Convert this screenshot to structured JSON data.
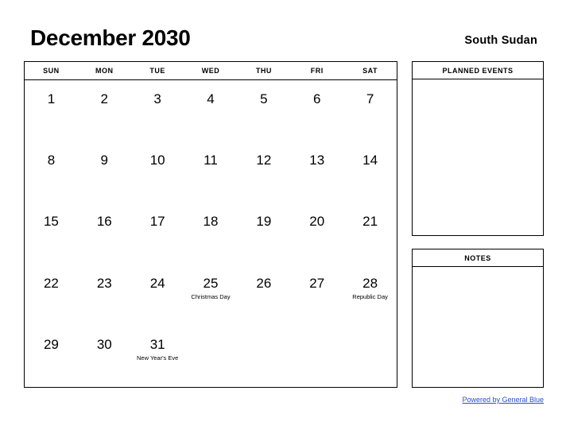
{
  "header": {
    "month_title": "December 2030",
    "country": "South Sudan"
  },
  "calendar": {
    "weekday_headers": [
      "SUN",
      "MON",
      "TUE",
      "WED",
      "THU",
      "FRI",
      "SAT"
    ],
    "weeks": [
      [
        {
          "day": "1",
          "event": ""
        },
        {
          "day": "2",
          "event": ""
        },
        {
          "day": "3",
          "event": ""
        },
        {
          "day": "4",
          "event": ""
        },
        {
          "day": "5",
          "event": ""
        },
        {
          "day": "6",
          "event": ""
        },
        {
          "day": "7",
          "event": ""
        }
      ],
      [
        {
          "day": "8",
          "event": ""
        },
        {
          "day": "9",
          "event": ""
        },
        {
          "day": "10",
          "event": ""
        },
        {
          "day": "11",
          "event": ""
        },
        {
          "day": "12",
          "event": ""
        },
        {
          "day": "13",
          "event": ""
        },
        {
          "day": "14",
          "event": ""
        }
      ],
      [
        {
          "day": "15",
          "event": ""
        },
        {
          "day": "16",
          "event": ""
        },
        {
          "day": "17",
          "event": ""
        },
        {
          "day": "18",
          "event": ""
        },
        {
          "day": "19",
          "event": ""
        },
        {
          "day": "20",
          "event": ""
        },
        {
          "day": "21",
          "event": ""
        }
      ],
      [
        {
          "day": "22",
          "event": ""
        },
        {
          "day": "23",
          "event": ""
        },
        {
          "day": "24",
          "event": ""
        },
        {
          "day": "25",
          "event": "Christmas Day"
        },
        {
          "day": "26",
          "event": ""
        },
        {
          "day": "27",
          "event": ""
        },
        {
          "day": "28",
          "event": "Republic Day"
        }
      ],
      [
        {
          "day": "29",
          "event": ""
        },
        {
          "day": "30",
          "event": ""
        },
        {
          "day": "31",
          "event": "New Year's Eve"
        },
        {
          "day": "",
          "event": ""
        },
        {
          "day": "",
          "event": ""
        },
        {
          "day": "",
          "event": ""
        },
        {
          "day": "",
          "event": ""
        }
      ]
    ]
  },
  "panels": {
    "planned_events": {
      "title": "PLANNED EVENTS",
      "content": ""
    },
    "notes": {
      "title": "NOTES",
      "content": ""
    }
  },
  "footer": {
    "link_text": "Powered by General Blue",
    "link_color": "#2b4ecb"
  }
}
